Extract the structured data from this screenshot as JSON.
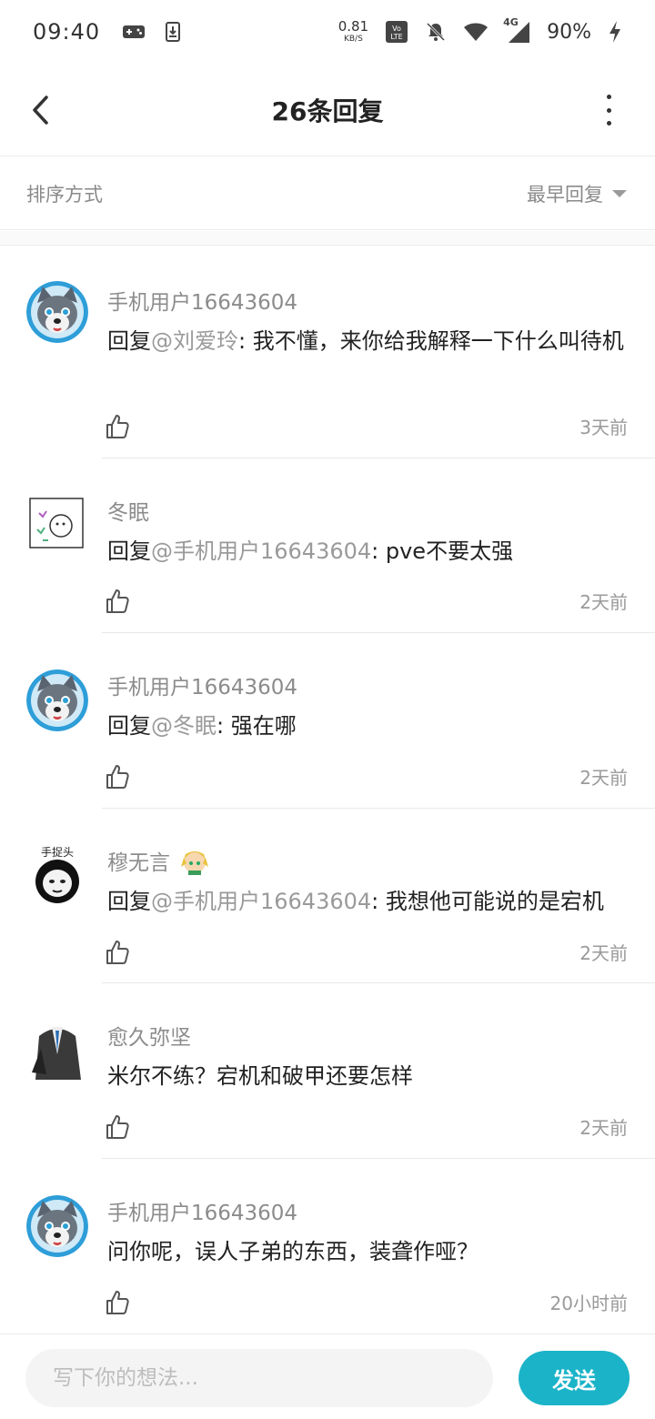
{
  "status_bar": {
    "time": "09:40",
    "net_speed_value": "0.81",
    "net_speed_unit": "KB/S",
    "network_label": "4G",
    "battery": "90%",
    "icons": [
      "gamepad-icon",
      "download-icon",
      "volte-icon",
      "mute-bell-icon",
      "wifi-icon",
      "signal-icon",
      "charging-icon"
    ]
  },
  "header": {
    "title": "26条回复",
    "back_icon": "chevron-left-icon",
    "more_icon": "more-vertical-icon"
  },
  "sort": {
    "label": "排序方式",
    "selected": "最早回复"
  },
  "comments": [
    {
      "name": "手机用户16643604",
      "reply_prefix": "回复",
      "mention": "@刘爱玲",
      "text": ": 我不懂，来你给我解释一下什么叫待机",
      "time": "3天前",
      "avatar": "wolf-avatar"
    },
    {
      "name": "冬眠",
      "reply_prefix": "回复",
      "mention": "@手机用户16643604",
      "text": ": pve不要太强",
      "time": "2天前",
      "avatar": "sketch-avatar"
    },
    {
      "name": "手机用户16643604",
      "reply_prefix": "回复",
      "mention": "@冬眠",
      "text": ": 强在哪",
      "time": "2天前",
      "avatar": "wolf-avatar"
    },
    {
      "name": "穆无言",
      "reply_prefix": "回复",
      "mention": "@手机用户16643604",
      "text": ": 我想他可能说的是宕机",
      "time": "2天前",
      "avatar": "panda-meme-avatar",
      "badge_icon": "elf-badge-icon"
    },
    {
      "name": "愈久弥坚",
      "reply_prefix": "",
      "mention": "",
      "text": "米尔不练？宕机和破甲还要怎样",
      "time": "2天前",
      "avatar": "suit-avatar"
    },
    {
      "name": "手机用户16643604",
      "reply_prefix": "",
      "mention": "",
      "text": "问你呢，误人子弟的东西，装聋作哑？",
      "time": "20小时前",
      "avatar": "wolf-avatar"
    }
  ],
  "composer": {
    "placeholder": "写下你的想法...",
    "send_label": "发送"
  },
  "colors": {
    "accent": "#1bb3c8",
    "muted_text": "#8c8c8c",
    "divider": "#e8e8e8"
  }
}
